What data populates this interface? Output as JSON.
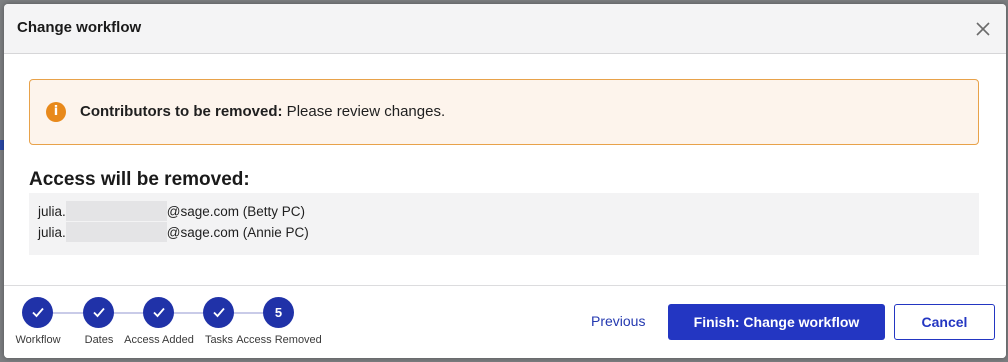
{
  "modal": {
    "title": "Change workflow",
    "close_icon": "close-icon"
  },
  "alert": {
    "icon": "info-icon",
    "icon_glyph": "i",
    "bold_text": "Contributors to be removed:",
    "text": " Please review changes.",
    "colors": {
      "border": "#e8a24a",
      "background": "#fdf4ec",
      "icon": "#e8891b"
    }
  },
  "access": {
    "heading": "Access will be removed:",
    "rows": [
      {
        "prefix": "julia.",
        "suffix": "@sage.com (Betty PC)"
      },
      {
        "prefix": "julia.",
        "suffix": "@sage.com (Annie PC)"
      }
    ]
  },
  "stepper": {
    "steps": [
      {
        "label": "Workflow",
        "state": "complete",
        "icon": "check-icon"
      },
      {
        "label": "Dates",
        "state": "complete",
        "icon": "check-icon"
      },
      {
        "label": "Access Added",
        "state": "complete",
        "icon": "check-icon"
      },
      {
        "label": "Tasks",
        "state": "complete",
        "icon": "check-icon"
      },
      {
        "label": "Access Removed",
        "state": "current",
        "number": "5"
      }
    ],
    "color": "#2032a8"
  },
  "footer": {
    "previous_label": "Previous",
    "finish_label": "Finish: Change workflow",
    "cancel_label": "Cancel",
    "accent": "#2336c2"
  }
}
